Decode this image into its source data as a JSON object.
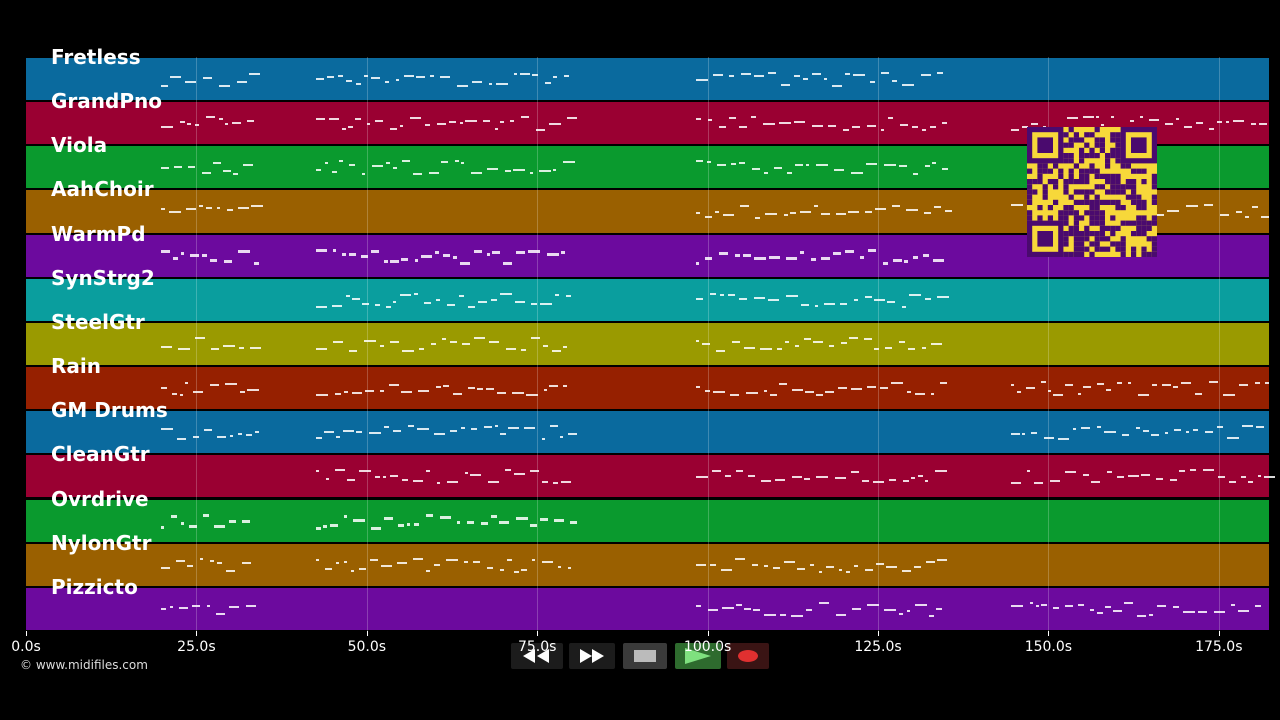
{
  "tracks": [
    {
      "name": "Fretless",
      "color": "#0a6a9e"
    },
    {
      "name": "GrandPno",
      "color": "#9a0032"
    },
    {
      "name": "Viola",
      "color": "#0a9a2e"
    },
    {
      "name": "AahChoir",
      "color": "#9a6000"
    },
    {
      "name": "WarmPd",
      "color": "#6c0a9e"
    },
    {
      "name": "SynStrg2",
      "color": "#0a9e9e"
    },
    {
      "name": "SteelGtr",
      "color": "#9a9a00"
    },
    {
      "name": "Rain",
      "color": "#962000"
    },
    {
      "name": "GM Drums",
      "color": "#0a6a9e"
    },
    {
      "name": "CleanGtr",
      "color": "#9a0032"
    },
    {
      "name": "Ovrdrive",
      "color": "#0a9a2e"
    },
    {
      "name": "NylonGtr",
      "color": "#9a6000"
    },
    {
      "name": "Pizzicto",
      "color": "#6c0a9e"
    }
  ],
  "timeline": {
    "ticks": [
      "0.0s",
      "25.0s",
      "50.0s",
      "75.0s",
      "100.0s",
      "125.0s",
      "150.0s",
      "175.0s"
    ],
    "tick_values": [
      0,
      25,
      50,
      75,
      100,
      125,
      150,
      175
    ]
  },
  "copyright": "© www.midifiles.com",
  "transport": {
    "buttons": [
      {
        "name": "rewind-button",
        "icon": "rewind-icon"
      },
      {
        "name": "fast-forward-button",
        "icon": "fast-forward-icon"
      },
      {
        "name": "stop-button",
        "icon": "stop-icon"
      },
      {
        "name": "play-button",
        "icon": "play-icon"
      },
      {
        "name": "record-button",
        "icon": "record-icon"
      }
    ],
    "colors": {
      "rewind": "#2a2a2a",
      "stop": "#444444",
      "play": "#2e8b2e",
      "record": "#4a1010"
    }
  },
  "qr_code": {
    "icon": "qr-code-icon",
    "color": "#f7d83a",
    "dark": "#4a0a6e"
  }
}
